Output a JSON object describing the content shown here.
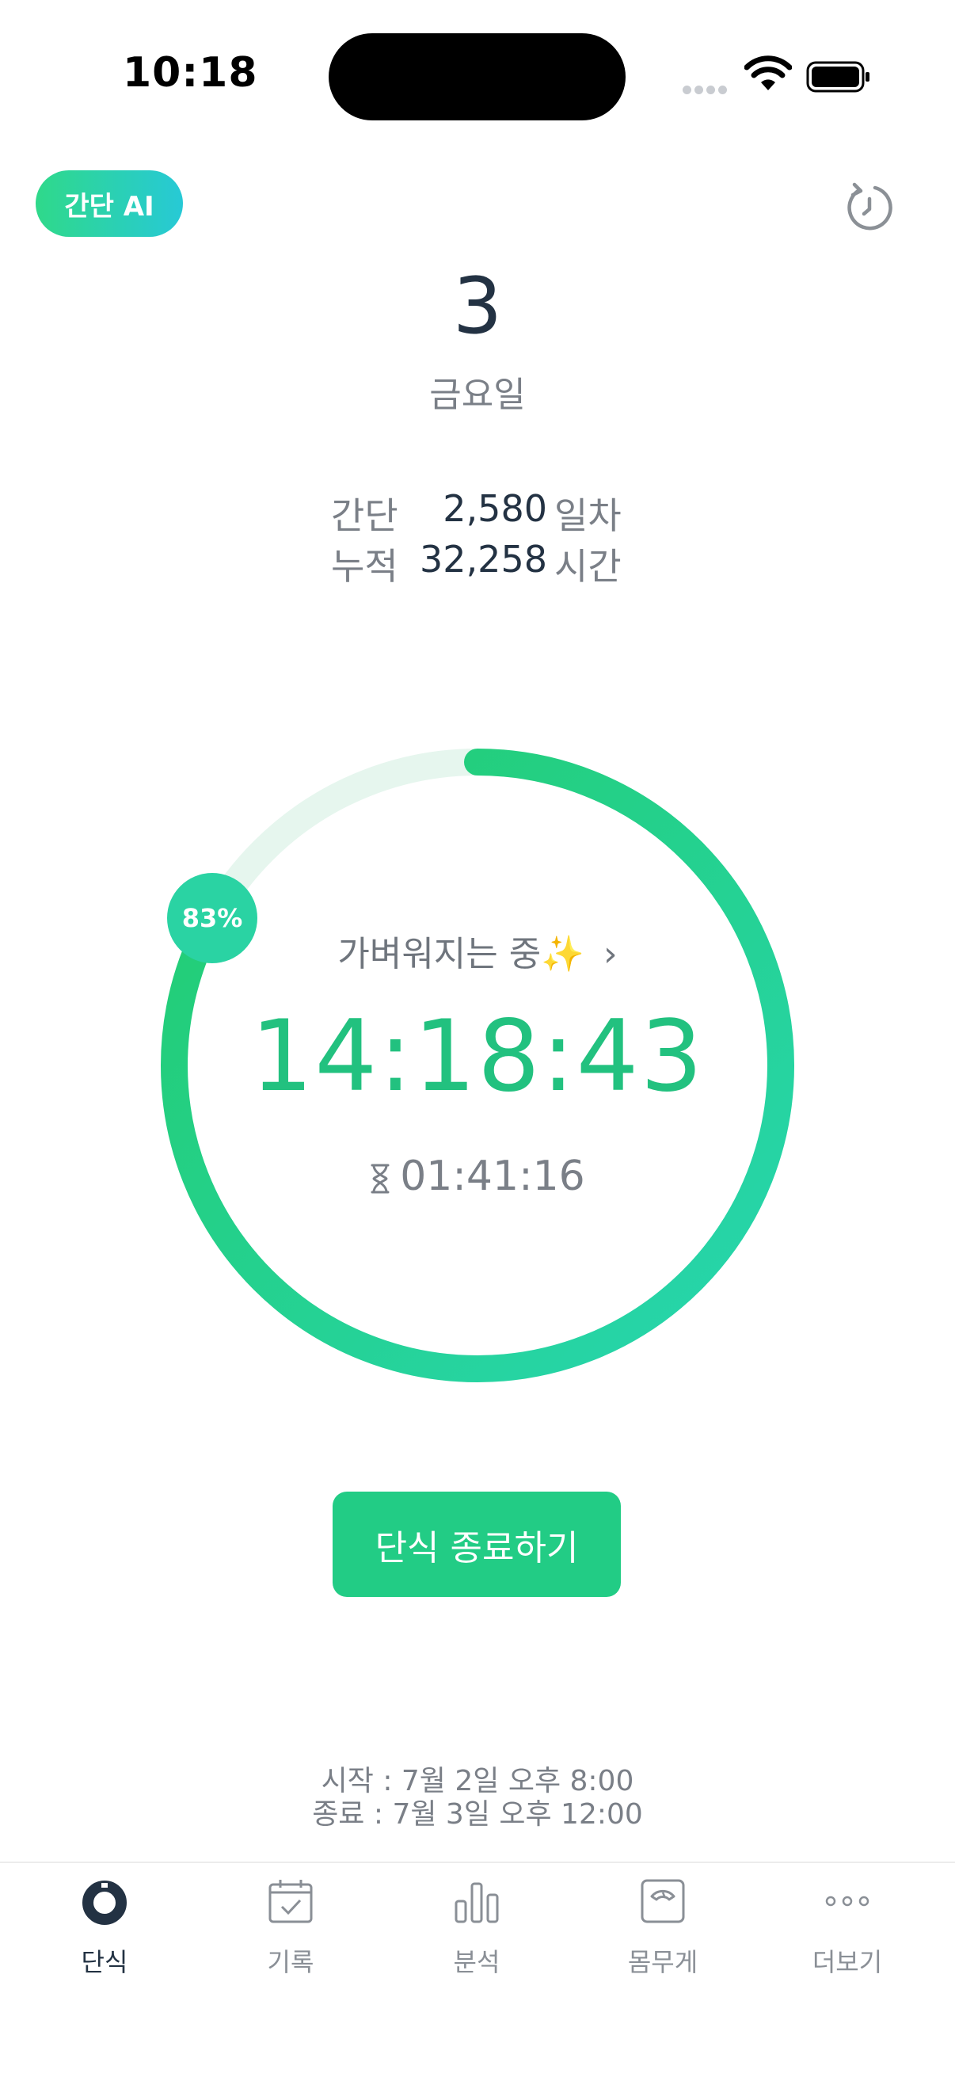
{
  "status_bar": {
    "time": "10:18"
  },
  "header": {
    "ai_badge": "간단 AI"
  },
  "date": {
    "day": "3",
    "weekday": "금요일"
  },
  "stats": [
    {
      "label": "간단",
      "value": "2,580",
      "unit": "일차"
    },
    {
      "label": "누적",
      "value": "32,258",
      "unit": "시간"
    }
  ],
  "timer": {
    "progress_percent": 83,
    "progress_label": "83%",
    "phase": "가벼워지는 중✨",
    "phase_chevron": "›",
    "elapsed": "14:18:43",
    "remaining": "01:41:16"
  },
  "end_button": "단식 종료하기",
  "schedule": {
    "start": "시작 : 7월 2일 오후 8:00",
    "end": "종료 : 7월 3일 오후 12:00"
  },
  "tabs": [
    {
      "label": "단식",
      "icon": "fasting-ring-icon",
      "active": true
    },
    {
      "label": "기록",
      "icon": "calendar-check-icon",
      "active": false
    },
    {
      "label": "분석",
      "icon": "bar-chart-icon",
      "active": false
    },
    {
      "label": "몸무게",
      "icon": "scale-icon",
      "active": false
    },
    {
      "label": "더보기",
      "icon": "more-dots-icon",
      "active": false
    }
  ],
  "colors": {
    "accent": "#22cc85",
    "ring_start": "#27d6b0",
    "ring_end": "#22cc6e",
    "ring_track": "#e6f6ee",
    "text_dark": "#233243",
    "text_muted": "#7a7f87"
  }
}
